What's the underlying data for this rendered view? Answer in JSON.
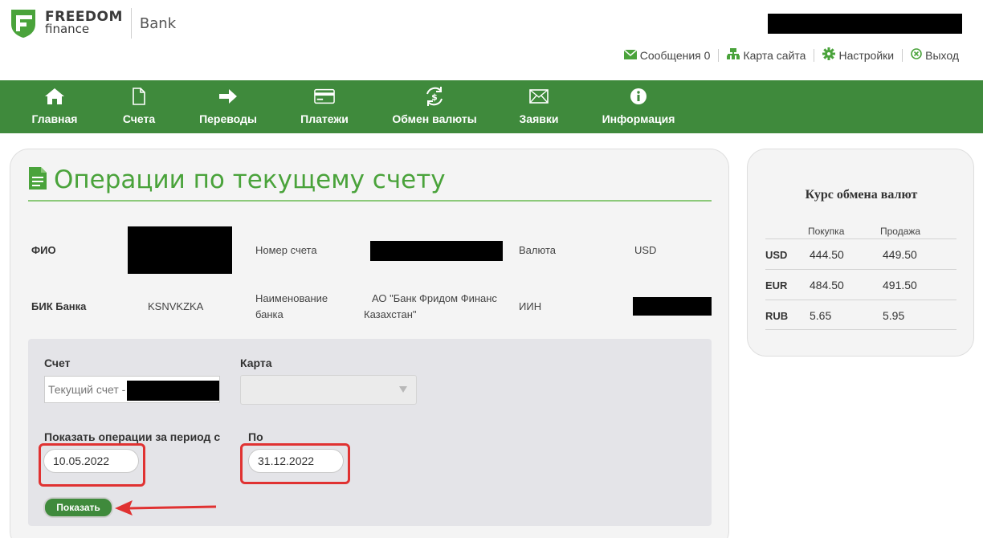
{
  "header": {
    "brand_line1": "FREEDOM",
    "brand_line2": "finance",
    "brand_bank": "Bank",
    "links": [
      {
        "icon": "envelope-icon",
        "label": "Сообщения 0"
      },
      {
        "icon": "sitemap-icon",
        "label": "Карта сайта"
      },
      {
        "icon": "gear-icon",
        "label": "Настройки"
      },
      {
        "icon": "logout-icon",
        "label": "Выход"
      }
    ]
  },
  "nav": {
    "items": [
      {
        "icon": "home-icon",
        "label": "Главная"
      },
      {
        "icon": "document-icon",
        "label": "Счета"
      },
      {
        "icon": "arrow-right-icon",
        "label": "Переводы"
      },
      {
        "icon": "card-icon",
        "label": "Платежи"
      },
      {
        "icon": "exchange-icon",
        "label": "Обмен валюты"
      },
      {
        "icon": "envelope-icon",
        "label": "Заявки"
      },
      {
        "icon": "info-icon",
        "label": "Информация"
      }
    ]
  },
  "main": {
    "title": "Операции по текущему счету",
    "info": {
      "fio_label": "ФИО",
      "account_number_label": "Номер счета",
      "currency_label": "Валюта",
      "currency_value": "USD",
      "bik_label": "БИК Банка",
      "bik_value": "KSNVKZKA",
      "bank_name_label_1": "Наименование",
      "bank_name_label_2": "банка",
      "bank_name_value_1": "АО \"Банк Фридом Финанс",
      "bank_name_value_2": "Казахстан\"",
      "iin_label": "ИИН"
    },
    "form": {
      "account_label": "Счет",
      "account_value": "Текущий счет -",
      "card_label": "Карта",
      "period_from_label": "Показать операции за период с",
      "period_from_value": "10.05.2022",
      "period_to_label": "По",
      "period_to_value": "31.12.2022",
      "show_button": "Показать"
    }
  },
  "rates": {
    "title": "Курс обмена валют",
    "buy_label": "Покупка",
    "sell_label": "Продажа",
    "rows": [
      {
        "code": "USD",
        "buy": "444.50",
        "sell": "449.50"
      },
      {
        "code": "EUR",
        "buy": "484.50",
        "sell": "491.50"
      },
      {
        "code": "RUB",
        "buy": "5.65",
        "sell": "5.95"
      }
    ]
  },
  "colors": {
    "brand_green": "#3f8a3c",
    "title_green": "#4aa33b",
    "highlight_red": "#e03232"
  }
}
